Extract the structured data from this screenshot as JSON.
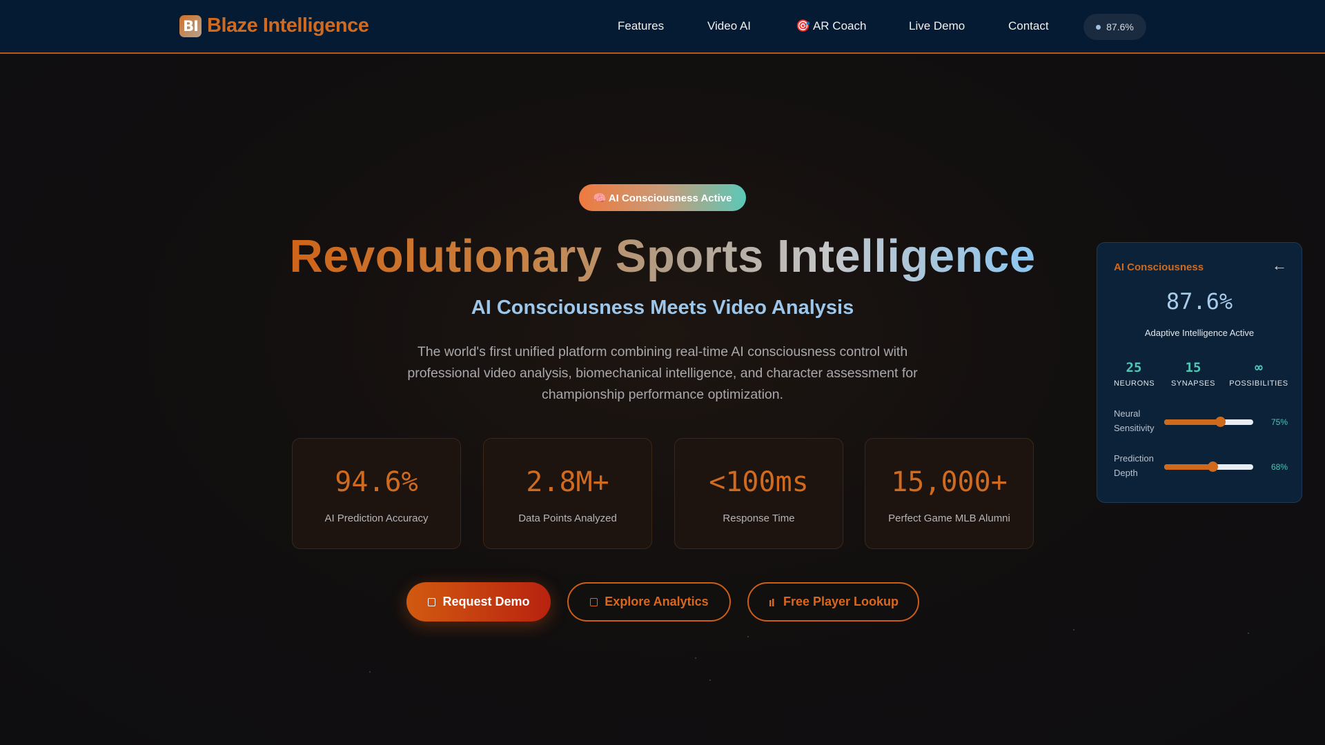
{
  "brand": {
    "logo_text": "BI",
    "name": "Blaze Intelligence"
  },
  "nav": {
    "links": [
      "Features",
      "Video AI",
      "🎯 AR Coach",
      "Live Demo",
      "Contact"
    ],
    "status_pill": "87.6%"
  },
  "hero": {
    "badge": "🧠 AI Consciousness Active",
    "title": "Revolutionary Sports Intelligence",
    "subtitle": "AI Consciousness Meets Video Analysis",
    "description": "The world's first unified platform combining real-time AI consciousness control with professional video analysis, biomechanical intelligence, and character assessment for championship performance optimization."
  },
  "stats": [
    {
      "value": "94.6%",
      "label": "AI Prediction Accuracy"
    },
    {
      "value": "2.8M+",
      "label": "Data Points Analyzed"
    },
    {
      "value": "<100ms",
      "label": "Response Time"
    },
    {
      "value": "15,000+",
      "label": "Perfect Game MLB Alumni"
    }
  ],
  "buttons": {
    "request_demo": "Request Demo",
    "explore_analytics": "Explore Analytics",
    "player_lookup": "Free Player Lookup",
    "player_lookup_icon": "🏻"
  },
  "panel": {
    "title": "AI Consciousness",
    "close": "←",
    "value": "87.6%",
    "status": "Adaptive Intelligence Active",
    "metrics": [
      {
        "value": "25",
        "label": "NEURONS"
      },
      {
        "value": "15",
        "label": "SYNAPSES"
      },
      {
        "value": "∞",
        "label": "POSSIBILITIES"
      }
    ],
    "sliders": [
      {
        "label": "Neural Sensitivity",
        "percent_text": "75%",
        "level": 0.63
      },
      {
        "label": "Prediction Depth",
        "percent_text": "68%",
        "level": 0.54
      }
    ]
  },
  "colors": {
    "nav_bg": "#051a33",
    "accent_orange": "#d06a1e",
    "accent_teal": "#4fc7b5",
    "accent_blue": "#9cc6ea"
  }
}
